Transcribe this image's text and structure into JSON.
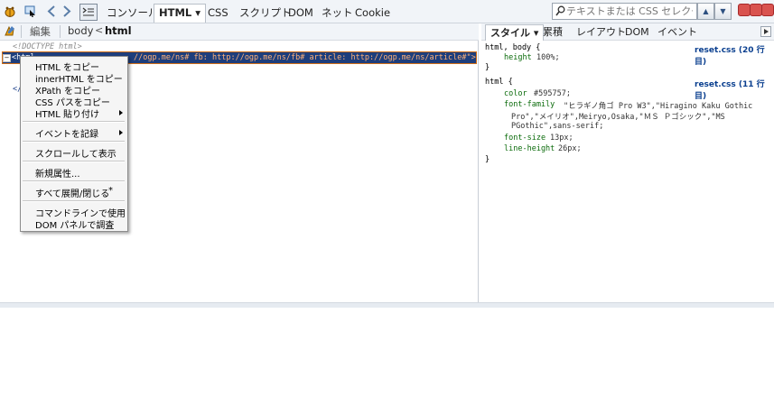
{
  "toolbar": {
    "tabs": [
      "コンソール",
      "HTML ▾",
      "CSS",
      "スクリプト",
      "DOM",
      "ネット",
      "Cookie"
    ],
    "search_placeholder": "テキストまたは CSS セレクタで検索",
    "up_glyph": "▲",
    "down_glyph": "▼"
  },
  "breadcrumb": {
    "edit_label": "編集",
    "crumb_body": "body",
    "separator": "<",
    "crumb_html": "html"
  },
  "side_panel": {
    "tabs": [
      "スタイル ▾",
      "累積",
      "レイアウト",
      "DOM",
      "イベント"
    ],
    "rules": [
      {
        "selector": "html, body {",
        "source": "reset.css (20 行目)",
        "props": [
          {
            "name": "height",
            "value": "100%;"
          }
        ],
        "close": "}"
      },
      {
        "selector": "html {",
        "source": "reset.css (11 行目)",
        "props": [
          {
            "name": "color",
            "value": "#595757;"
          },
          {
            "name": "font-family",
            "value": "\"ヒラギノ角ゴ Pro W3\",\"Hiragino Kaku Gothic"
          },
          {
            "name": "",
            "value": "Pro\",\"メイリオ\",Meiryo,Osaka,\"ＭＳ Ｐゴシック\",\"MS"
          },
          {
            "name": "",
            "value": "PGothic\",sans-serif;"
          },
          {
            "name": "font-size",
            "value": "13px;"
          },
          {
            "name": "line-height",
            "value": "26px;"
          }
        ],
        "close": "}"
      }
    ]
  },
  "html_tree": {
    "doctype": "<!DOCTYPE html>",
    "html_open": "<html",
    "html_attrs": "//ogp.me/ns# fb: http://ogp.me/ns/fb# article: http://ogp.me/ns/article#\">",
    "html_close": "</"
  },
  "context_menu": {
    "items": [
      {
        "label": "HTML をコピー"
      },
      {
        "label": "innerHTML をコピー"
      },
      {
        "label": "XPath をコピー"
      },
      {
        "label": "CSS パスをコピー"
      },
      {
        "label": "HTML 貼り付け"
      },
      {
        "label": "イベントを記録"
      },
      {
        "label": "スクロールして表示"
      },
      {
        "label": "新規属性..."
      },
      {
        "label": "すべて展開/閉じる"
      },
      {
        "label": "コマンドラインで使用"
      },
      {
        "label": "DOM パネルで調査"
      }
    ],
    "expand_shortcut": "*"
  }
}
